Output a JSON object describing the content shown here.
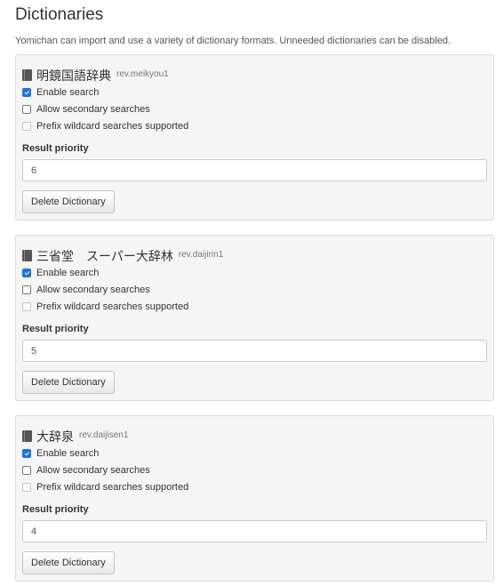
{
  "header": {
    "title": "Dictionaries",
    "description": "Yomichan can import and use a variety of dictionary formats. Unneeded dictionaries can be disabled."
  },
  "dictionaries": [
    {
      "name": "明鏡国語辞典",
      "revision": "rev.meikyou1",
      "enable_search_label": "Enable search",
      "enable_search_checked": true,
      "secondary_label": "Allow secondary searches",
      "secondary_checked": false,
      "prefix_label": "Prefix wildcard searches supported",
      "prefix_checked": false,
      "priority_label": "Result priority",
      "priority_value": "6",
      "delete_label": "Delete Dictionary"
    },
    {
      "name": "三省堂　スーパー大辞林",
      "revision": "rev.daijirin1",
      "enable_search_label": "Enable search",
      "enable_search_checked": true,
      "secondary_label": "Allow secondary searches",
      "secondary_checked": false,
      "prefix_label": "Prefix wildcard searches supported",
      "prefix_checked": false,
      "priority_label": "Result priority",
      "priority_value": "5",
      "delete_label": "Delete Dictionary"
    },
    {
      "name": "大辞泉",
      "revision": "rev.daijisen1",
      "enable_search_label": "Enable search",
      "enable_search_checked": true,
      "secondary_label": "Allow secondary searches",
      "secondary_checked": false,
      "prefix_label": "Prefix wildcard searches supported",
      "prefix_checked": false,
      "priority_label": "Result priority",
      "priority_value": "4",
      "delete_label": "Delete Dictionary"
    }
  ],
  "icons": {
    "dictionary": "book-icon"
  },
  "colors": {
    "checkbox_checked": "#1a73e8",
    "panel_bg": "#f5f5f5",
    "panel_border": "#dcdcdc"
  }
}
